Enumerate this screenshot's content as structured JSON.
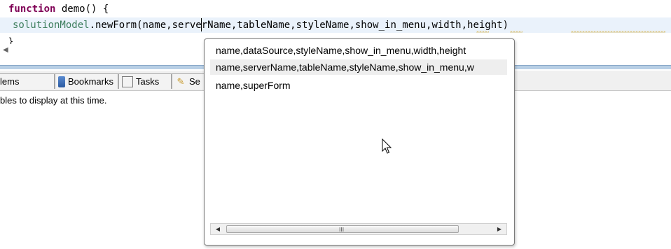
{
  "editor": {
    "line1": {
      "keyword": "function",
      "rest": " demo() {"
    },
    "line2": {
      "receiver": "solutionModel",
      "call": ".newForm(",
      "args": "name,serverName,tableName,styleName,show_in_menu,width,height)"
    },
    "line3": "}"
  },
  "views_tabs": [
    {
      "label": "lems",
      "icon": "problems-icon"
    },
    {
      "label": "Bookmarks",
      "icon": "bookmarks-icon"
    },
    {
      "label": "Tasks",
      "icon": "tasks-icon"
    },
    {
      "label": "Se",
      "icon": "search-icon"
    }
  ],
  "views_content": {
    "message": "bles to display at this time."
  },
  "content_assist": {
    "proposals": [
      "name,dataSource,styleName,show_in_menu,width,height",
      "name,serverName,tableName,styleName,show_in_menu,w",
      "name,superForm"
    ],
    "scroll_grip": "III",
    "selected_index": 1
  },
  "colors": {
    "keyword": "#7f0055",
    "identifier": "#3f7f5f",
    "selection": "#eeeeee",
    "divider": "#b8cfe5"
  }
}
